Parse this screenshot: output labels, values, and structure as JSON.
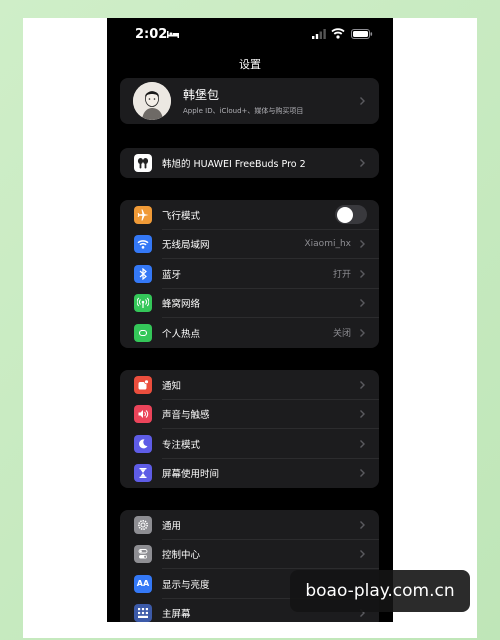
{
  "status_bar": {
    "time": "2:02"
  },
  "header": {
    "title": "设置"
  },
  "profile": {
    "name": "韩堡包",
    "subtitle": "Apple ID、iCloud+、媒体与购买项目"
  },
  "device": {
    "label": "韩旭的 HUAWEI FreeBuds Pro 2"
  },
  "connectivity": [
    {
      "label": "飞行模式",
      "icon": "airplane-icon",
      "color": "#f09a37",
      "toggle": false
    },
    {
      "label": "无线局域网",
      "icon": "wifi-icon",
      "color": "#3478f6",
      "value": "Xiaomi_hx"
    },
    {
      "label": "蓝牙",
      "icon": "bluetooth-icon",
      "color": "#3478f6",
      "value": "打开"
    },
    {
      "label": "蜂窝网络",
      "icon": "cellular-icon",
      "color": "#34c759"
    },
    {
      "label": "个人热点",
      "icon": "hotspot-icon",
      "color": "#34c759",
      "value": "关闭"
    }
  ],
  "notifications": [
    {
      "label": "通知",
      "icon": "notification-icon",
      "color": "#eb4e3d"
    },
    {
      "label": "声音与触感",
      "icon": "sound-icon",
      "color": "#eb445a"
    },
    {
      "label": "专注模式",
      "icon": "moon-icon",
      "color": "#5e5ce6"
    },
    {
      "label": "屏幕使用时间",
      "icon": "hourglass-icon",
      "color": "#5e5ce6"
    }
  ],
  "general": [
    {
      "label": "通用",
      "icon": "gear-icon",
      "color": "#8e8e93"
    },
    {
      "label": "控制中心",
      "icon": "switches-icon",
      "color": "#8e8e93"
    },
    {
      "label": "显示与亮度",
      "icon": "text-size-icon",
      "color": "#3478f6",
      "glyph": "AA"
    },
    {
      "label": "主屏幕",
      "icon": "home-grid-icon",
      "color": "#3c5aa8"
    }
  ],
  "watermark": {
    "text": "boao-play.com.cn"
  }
}
